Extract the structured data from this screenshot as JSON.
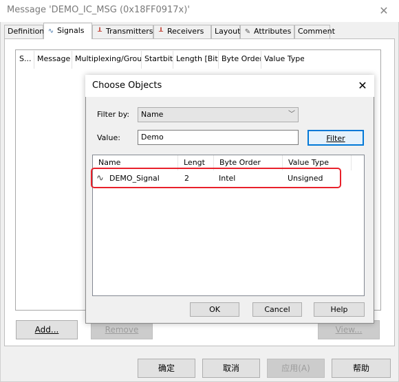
{
  "window": {
    "title": "Message 'DEMO_IC_MSG (0x18FF0917x)'",
    "close_glyph": "✕"
  },
  "tabs": [
    {
      "label": "Definition",
      "icon": ""
    },
    {
      "label": "Signals",
      "icon": "signal-wave-icon"
    },
    {
      "label": "Transmitters",
      "icon": "node-icon"
    },
    {
      "label": "Receivers",
      "icon": "node-icon"
    },
    {
      "label": "Layout",
      "icon": ""
    },
    {
      "label": "Attributes",
      "icon": "pencil-icon"
    },
    {
      "label": "Comment",
      "icon": ""
    }
  ],
  "signals_grid": {
    "columns": [
      "S...",
      "Message",
      "Multiplexing/Group",
      "Startbit",
      "Length [Bit]",
      "Byte Order",
      "Value Type"
    ]
  },
  "signals_buttons": {
    "add": "Add...",
    "remove": "Remove",
    "view": "View..."
  },
  "footer_buttons": {
    "ok": "确定",
    "cancel": "取消",
    "apply": "应用(A)",
    "help": "帮助"
  },
  "dialog": {
    "title": "Choose Objects",
    "close_glyph": "✕",
    "filter_by_label": "Filter by:",
    "filter_by_value": "Name",
    "value_label": "Value:",
    "value_text": "Demo",
    "filter_button": "Filter",
    "list": {
      "columns": [
        "Name",
        "Lengt",
        "Byte Order",
        "Value Type"
      ],
      "rows": [
        {
          "name": "DEMO_Signal",
          "length": "2",
          "byte_order": "Intel",
          "value_type": "Unsigned"
        }
      ]
    },
    "buttons": {
      "ok": "OK",
      "cancel": "Cancel",
      "help": "Help"
    }
  },
  "colors": {
    "highlight_border": "#e8202a",
    "window_bg": "#f0f0f0"
  }
}
